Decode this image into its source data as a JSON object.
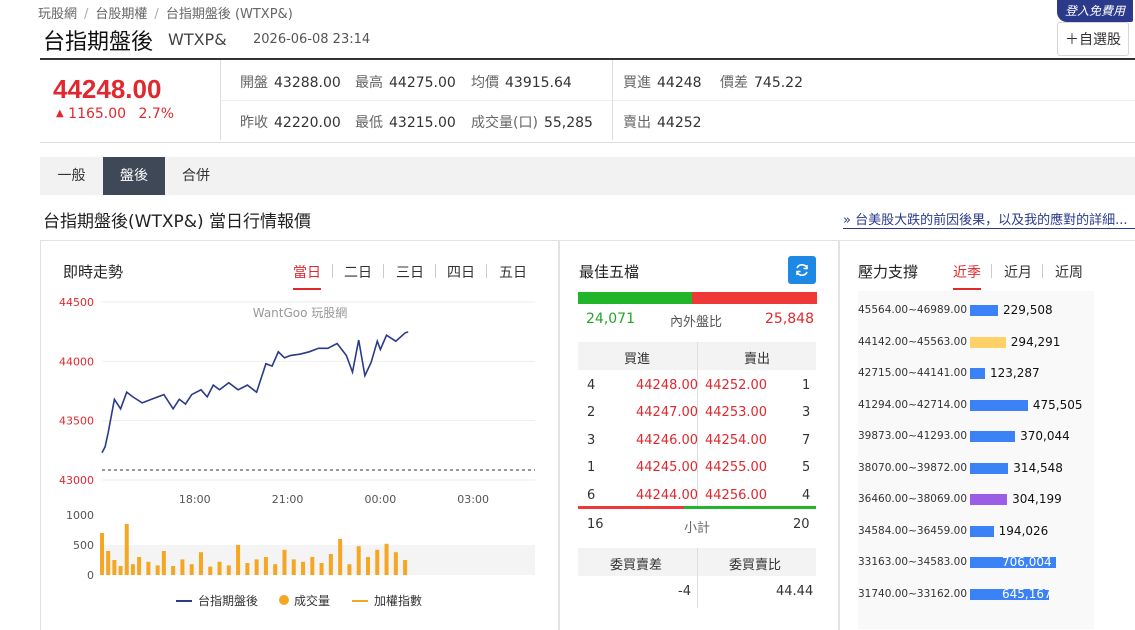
{
  "breadcrumb": {
    "items": [
      "玩股網",
      "台股期權",
      "台指期盤後 (WTXP&)"
    ]
  },
  "login_badge": "登入免費用",
  "fav_button": "＋自選股",
  "header": {
    "title": "台指期盤後",
    "code": "WTXP&",
    "datetime": "2026-06-08 23:14"
  },
  "quote": {
    "price": "44248.00",
    "change": "1165.00",
    "change_pct": "2.7%",
    "open_label": "開盤",
    "open": "43288.00",
    "high_label": "最高",
    "high": "44275.00",
    "avg_label": "均價",
    "avg": "43915.64",
    "bid_label": "買進",
    "bid": "44248",
    "spread_label": "價差",
    "spread": "745.22",
    "prev_label": "昨收",
    "prev": "42220.00",
    "low_label": "最低",
    "low": "43215.00",
    "vol_label": "成交量(口)",
    "vol": "55,285",
    "ask_label": "賣出",
    "ask": "44252"
  },
  "tabs": [
    "一般",
    "盤後",
    "合併"
  ],
  "active_tab": "盤後",
  "section_title": "台指期盤後(WTXP&) 當日行情報價",
  "news_link": "» 台美股大跌的前因後果，以及我的應對的詳細...",
  "trend": {
    "title": "即時走勢",
    "range_tabs": [
      "當日",
      "二日",
      "三日",
      "四日",
      "五日"
    ],
    "active_range": "當日",
    "watermark": "WantGoo 玩股網",
    "legend": [
      "台指期盤後",
      "成交量",
      "加權指數"
    ]
  },
  "chart_data": {
    "type": "line",
    "y_ticks": [
      "44500",
      "44000",
      "43500",
      "43000"
    ],
    "x_ticks": [
      "18:00",
      "21:00",
      "00:00",
      "03:00"
    ],
    "vol_ticks": [
      "1000",
      "500",
      "0"
    ],
    "ylim": [
      43000,
      44500
    ],
    "prev_close": 42220,
    "series": [
      {
        "name": "台指期盤後",
        "color": "#2b3a8b",
        "x": [
          15.0,
          15.1,
          15.2,
          15.4,
          15.6,
          15.8,
          16.0,
          16.3,
          16.6,
          17.0,
          17.3,
          17.5,
          17.7,
          17.9,
          18.2,
          18.4,
          18.6,
          18.8,
          19.1,
          19.4,
          19.7,
          20.0,
          20.3,
          20.5,
          20.7,
          20.9,
          21.1,
          21.4,
          21.7,
          22.0,
          22.3,
          22.6,
          22.9,
          23.1,
          23.3,
          23.5,
          23.7,
          23.9,
          24.0,
          24.2,
          24.5,
          24.8,
          24.9
        ],
        "values": [
          43230,
          43280,
          43400,
          43680,
          43600,
          43740,
          43700,
          43650,
          43680,
          43720,
          43600,
          43680,
          43640,
          43720,
          43760,
          43700,
          43800,
          43760,
          43820,
          43760,
          43800,
          43740,
          43980,
          43960,
          44080,
          44030,
          44050,
          44060,
          44080,
          44110,
          44110,
          44150,
          44050,
          43910,
          44180,
          43880,
          43990,
          44170,
          44100,
          44220,
          44170,
          44240,
          44248
        ]
      },
      {
        "name": "成交量",
        "color": "#f5a623",
        "x": [
          15.0,
          15.2,
          15.4,
          15.6,
          15.8,
          16.0,
          16.2,
          16.5,
          16.8,
          17.0,
          17.3,
          17.6,
          17.9,
          18.2,
          18.5,
          18.8,
          19.1,
          19.4,
          19.7,
          20.0,
          20.3,
          20.6,
          20.9,
          21.2,
          21.5,
          21.8,
          22.1,
          22.4,
          22.7,
          23.0,
          23.3,
          23.6,
          23.9,
          24.2,
          24.5,
          24.8
        ],
        "values": [
          700,
          400,
          250,
          150,
          850,
          180,
          300,
          220,
          160,
          400,
          150,
          260,
          180,
          380,
          140,
          220,
          160,
          500,
          200,
          260,
          300,
          180,
          420,
          260,
          220,
          300,
          200,
          350,
          600,
          180,
          480,
          300,
          420,
          520,
          380,
          250
        ]
      }
    ]
  },
  "orderbook": {
    "title": "最佳五檔",
    "inner": "24,071",
    "inner_label": "內外盤比",
    "outer": "25,848",
    "bid_header": "買進",
    "ask_header": "賣出",
    "rows": [
      {
        "bq": "4",
        "bp": "44248.00",
        "ap": "44252.00",
        "aq": "1"
      },
      {
        "bq": "2",
        "bp": "44247.00",
        "ap": "44253.00",
        "aq": "3"
      },
      {
        "bq": "3",
        "bp": "44246.00",
        "ap": "44254.00",
        "aq": "7"
      },
      {
        "bq": "1",
        "bp": "44245.00",
        "ap": "44255.00",
        "aq": "5"
      },
      {
        "bq": "6",
        "bp": "44244.00",
        "ap": "44256.00",
        "aq": "4"
      }
    ],
    "subtotal_bid": "16",
    "subtotal_label": "小計",
    "subtotal_ask": "20",
    "diff_label": "委買賣差",
    "ratio_label": "委買賣比",
    "diff_value": "-4",
    "ratio_value": "44.44"
  },
  "pressure": {
    "title": "壓力支撐",
    "tabs": [
      "近季",
      "近月",
      "近周"
    ],
    "active": "近季",
    "rows": [
      {
        "range": "45564.00~46989.00",
        "value": "229,508",
        "num": 229508,
        "color": "#3b82f6"
      },
      {
        "range": "44142.00~45563.00",
        "value": "294,291",
        "num": 294291,
        "color": "#ffd166"
      },
      {
        "range": "42715.00~44141.00",
        "value": "123,287",
        "num": 123287,
        "color": "#3b82f6"
      },
      {
        "range": "41294.00~42714.00",
        "value": "475,505",
        "num": 475505,
        "color": "#3b82f6"
      },
      {
        "range": "39873.00~41293.00",
        "value": "370,044",
        "num": 370044,
        "color": "#3b82f6"
      },
      {
        "range": "38070.00~39872.00",
        "value": "314,548",
        "num": 314548,
        "color": "#3b82f6"
      },
      {
        "range": "36460.00~38069.00",
        "value": "304,199",
        "num": 304199,
        "color": "#9b5de5"
      },
      {
        "range": "34584.00~36459.00",
        "value": "194,026",
        "num": 194026,
        "color": "#3b82f6"
      },
      {
        "range": "33163.00~34583.00",
        "value": "706,004",
        "num": 706004,
        "color": "#3b82f6"
      },
      {
        "range": "31740.00~33162.00",
        "value": "645,167",
        "num": 645167,
        "color": "#3b82f6"
      }
    ]
  }
}
